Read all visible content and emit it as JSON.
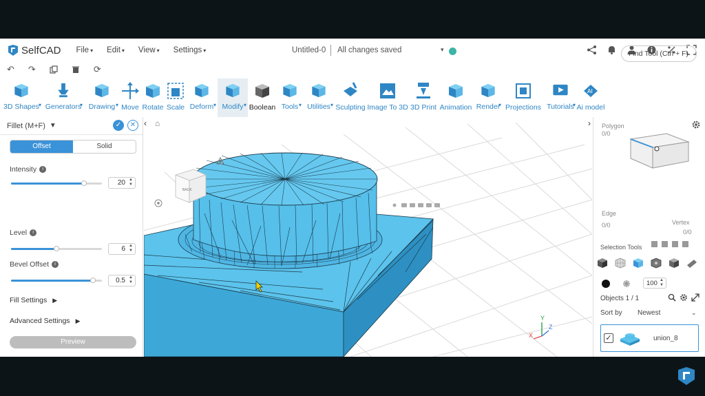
{
  "menubar": {
    "app_name": "SelfCAD",
    "menus": [
      "File",
      "Edit",
      "View",
      "Settings"
    ],
    "doc_title": "Untitled-0",
    "save_status": "All changes saved"
  },
  "toolbar": {
    "tools": [
      {
        "label": "3D Shapes",
        "dropdown": true,
        "icon": "cube-icon"
      },
      {
        "label": "Generators",
        "dropdown": true,
        "icon": "generator-icon"
      },
      {
        "label": "Drawing",
        "dropdown": true,
        "icon": "drawing-icon"
      },
      {
        "label": "Move",
        "dropdown": false,
        "icon": "move-icon"
      },
      {
        "label": "Rotate",
        "dropdown": false,
        "icon": "rotate-icon"
      },
      {
        "label": "Scale",
        "dropdown": false,
        "icon": "scale-icon"
      },
      {
        "label": "Deform",
        "dropdown": true,
        "icon": "deform-icon"
      },
      {
        "label": "Modify",
        "dropdown": true,
        "icon": "modify-icon",
        "active": true
      },
      {
        "label": "Boolean",
        "dropdown": false,
        "icon": "boolean-icon",
        "dark": true
      },
      {
        "label": "Tools",
        "dropdown": true,
        "icon": "tools-icon"
      },
      {
        "label": "Utilities",
        "dropdown": true,
        "icon": "utilities-icon"
      },
      {
        "label": "Sculpting",
        "dropdown": false,
        "icon": "sculpting-icon"
      },
      {
        "label": "Image To 3D",
        "dropdown": false,
        "icon": "image-to-3d-icon"
      },
      {
        "label": "3D Print",
        "dropdown": false,
        "icon": "print-icon"
      },
      {
        "label": "Animation",
        "dropdown": false,
        "icon": "animation-icon"
      },
      {
        "label": "Render",
        "dropdown": true,
        "icon": "render-icon"
      },
      {
        "label": "Projections",
        "dropdown": false,
        "icon": "projections-icon"
      },
      {
        "label": "Tutorials",
        "dropdown": true,
        "icon": "tutorials-icon"
      },
      {
        "label": "Ai model",
        "dropdown": false,
        "icon": "ai-model-icon"
      }
    ],
    "find_tool": "Find Tool (Ctrl + F)"
  },
  "left_panel": {
    "title": "Fillet (M+F)",
    "tabs": [
      "Offset",
      "Solid"
    ],
    "active_tab": "Offset",
    "params": [
      {
        "label": "Intensity",
        "value": "20",
        "fraction": 0.8
      },
      {
        "label": "Level",
        "value": "6",
        "fraction": 0.5
      },
      {
        "label": "Bevel Offset",
        "value": "0.5",
        "fraction": 0.9
      }
    ],
    "fill_settings": "Fill Settings",
    "advanced_settings": "Advanced Settings",
    "preview": "Preview"
  },
  "viewcube": {
    "front": "BACK"
  },
  "right_panel": {
    "polygon_label": "Polygon",
    "polygon_count": "0/0",
    "edge_label": "Edge",
    "edge_count": "0/0",
    "vertex_label": "Vertex",
    "vertex_count": "0/0",
    "selection_tools": "Selection Tools",
    "opacity": "100",
    "objects": "Objects 1 / 1",
    "sort_by": "Sort by",
    "sort_value": "Newest",
    "object_name": "union_8"
  },
  "axis": {
    "x": "X",
    "y": "Y",
    "z": "Z"
  },
  "colors": {
    "accent": "#3a92d8",
    "model": "#4db8e8",
    "tool_blue": "#2f86c4"
  }
}
